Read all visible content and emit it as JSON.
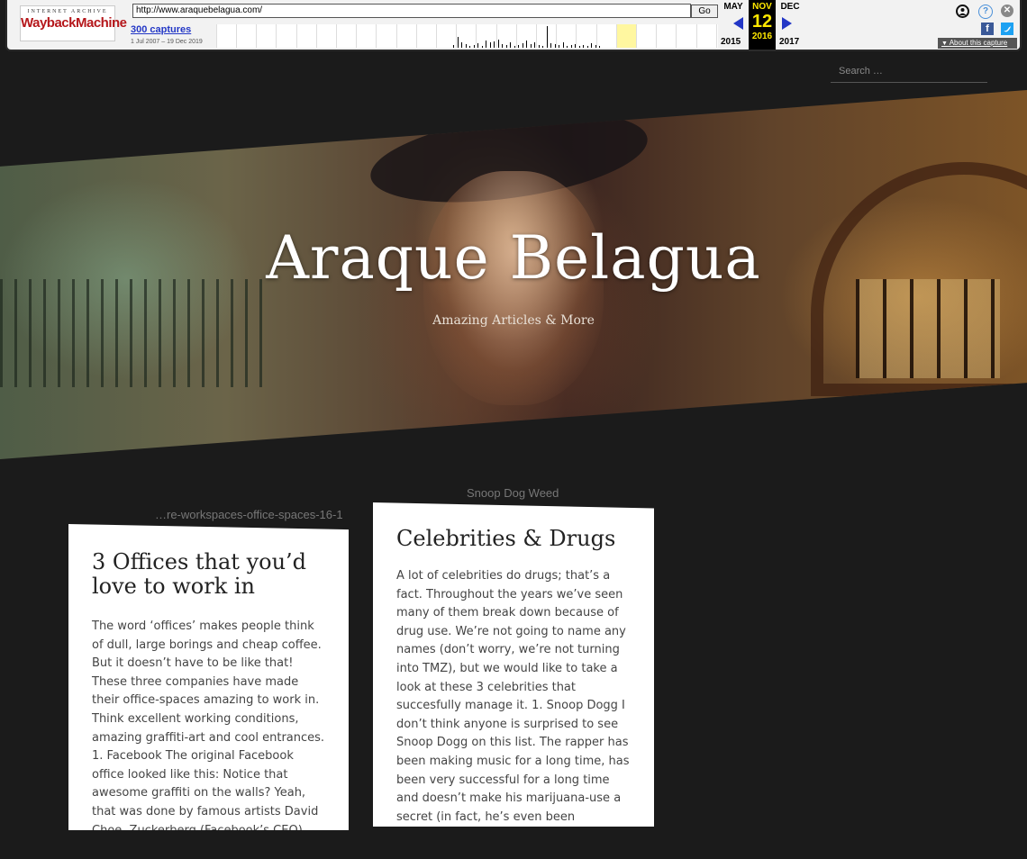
{
  "wayback": {
    "logo_top": "INTERNET ARCHIVE",
    "logo_main": "WaybackMachine",
    "url": "http://www.araquebelagua.com/",
    "go_label": "Go",
    "captures": "300 captures",
    "range": "1 Jul 2007 – 19 Dec 2019",
    "prev_month": "MAY",
    "cur_month": "NOV",
    "next_month": "DEC",
    "cur_day": "12",
    "prev_year": "2015",
    "cur_year": "2016",
    "next_year": "2017",
    "about": "About this capture",
    "fb": "f"
  },
  "search": {
    "placeholder": "Search …"
  },
  "hero": {
    "title": "Araque Belagua",
    "tagline": "Amazing Articles & More"
  },
  "posts": [
    {
      "image_alt": "…re-workspaces-office-spaces-16-1",
      "title": "3 Offices that you’d love to work in",
      "excerpt": "The word ‘offices’ makes people think of dull, large borings and cheap coffee. But it doesn’t have to be like that! These three companies have made their office-spaces amazing to work in. Think excellent working conditions, amazing graffiti-art and cool entrances. 1. Facebook The original Facebook office looked like this: Notice that awesome graffiti on the walls? Yeah, that was done by famous artists David Choe. Zuckerberg (Facebook’s CEO) invited Choe to make some murials in"
    },
    {
      "image_alt": "Snoop Dog Weed",
      "title": "Celebrities & Drugs",
      "excerpt": "A lot of celebrities do drugs; that’s a fact. Throughout the years we’ve seen many of them break down because of drug use. We’re not going to name any names (don’t worry, we’re not turning into TMZ), but we would like to take a look at these 3 celebrities that succesfully manage it.    1. Snoop Dogg I don’t think anyone is surprised to see Snoop Dogg on this list. The rapper has been making music for a long time, has been very successful for a long time and doesn’t make his marijuana-use a secret (in fact, he’s even been advocating it). Nobody really knows"
    }
  ]
}
